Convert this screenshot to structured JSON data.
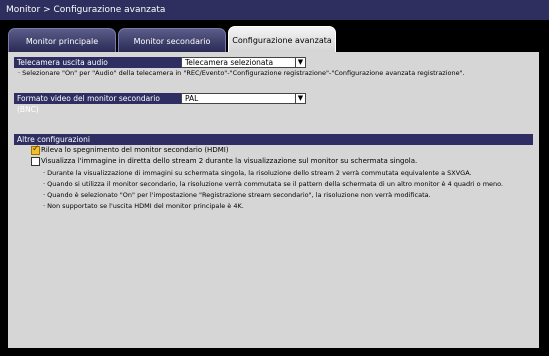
{
  "titlebar": {
    "title": "Monitor > Configurazione avanzata"
  },
  "tabs": [
    {
      "label": "Monitor principale",
      "active": false
    },
    {
      "label": "Monitor secondario",
      "active": false
    },
    {
      "label": "Configurazione avanzata",
      "active": true
    }
  ],
  "audio_camera": {
    "label": "Telecamera uscita audio",
    "value": "Telecamera selezionata",
    "note": "· Selezionare \"On\" per \"Audio\" della telecamera in \"REC/Evento\"-\"Configurazione registrazione\"-\"Configurazione avanzata registrazione\"."
  },
  "video_format": {
    "label": "Formato video del monitor secondario (BNC)",
    "value": "PAL"
  },
  "other": {
    "header": "Altre configurazioni",
    "hdmi_off": {
      "label": "Rileva lo spegnimento del monitor secondario (HDMI)",
      "checked": true
    },
    "stream2": {
      "label": "Visualizza l'immagine in diretta dello stream 2 durante la visualizzazione sul monitor su schermata singola.",
      "checked": false
    },
    "notes": [
      "· Durante la visualizzazione di immagini su schermata singola, la risoluzione dello stream 2 verrà commutata equivalente a SXVGA.",
      "· Quando si utilizza il monitor secondario, la risoluzione verrà commutata se il pattern della schermata di un altro monitor è 4 quadri o meno.",
      "· Quando è selezionato \"On\" per l'impostazione \"Registrazione stream secondario\", la risoluzione non verrà modificata.",
      "· Non supportato se l'uscita HDMI del monitor principale è 4K."
    ]
  },
  "colors": {
    "header_bar": "#2e2e62",
    "panel": "#d6d6d6",
    "checkbox_checked": "#f0c030"
  }
}
